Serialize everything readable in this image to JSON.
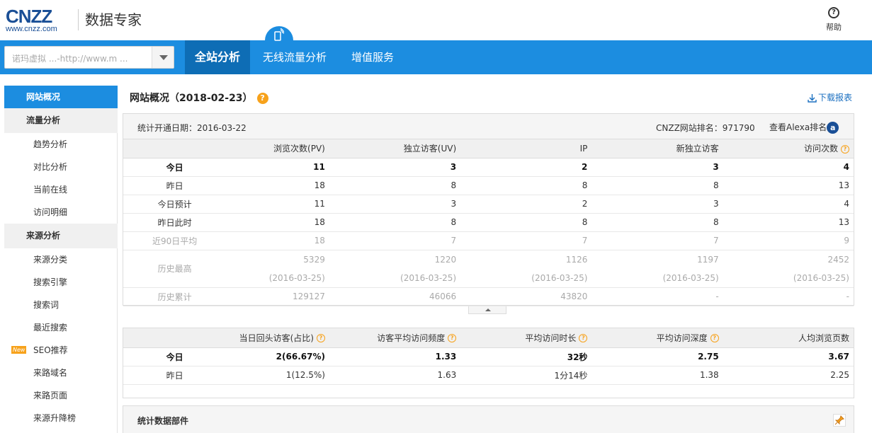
{
  "header": {
    "logo_main": "CNZZ",
    "logo_sub": "www.cnzz.com",
    "brand": "数据专家",
    "help_label": "帮助"
  },
  "site_select": {
    "value": "诺玛虚拟 ...-http://www.m ..."
  },
  "nav": {
    "tabs": [
      "全站分析",
      "无线流量分析",
      "增值服务"
    ],
    "active": "全站分析"
  },
  "sidebar": {
    "items": [
      {
        "label": "网站概况",
        "type": "active"
      },
      {
        "label": "流量分析",
        "type": "group"
      },
      {
        "label": "趋势分析",
        "type": "sub"
      },
      {
        "label": "对比分析",
        "type": "sub"
      },
      {
        "label": "当前在线",
        "type": "sub"
      },
      {
        "label": "访问明细",
        "type": "sub"
      },
      {
        "label": "来源分析",
        "type": "group"
      },
      {
        "label": "来源分类",
        "type": "sub"
      },
      {
        "label": "搜索引擎",
        "type": "sub"
      },
      {
        "label": "搜索词",
        "type": "sub"
      },
      {
        "label": "最近搜索",
        "type": "sub"
      },
      {
        "label": "SEO推荐",
        "type": "sub",
        "badge": "New"
      },
      {
        "label": "来路域名",
        "type": "sub"
      },
      {
        "label": "来路页面",
        "type": "sub"
      },
      {
        "label": "来源升降榜",
        "type": "sub"
      }
    ]
  },
  "main": {
    "title": "网站概况（2018-02-23）",
    "download_label": "下载报表",
    "open_date": "统计开通日期：2016-03-22",
    "rank": "CNZZ网站排名：971790",
    "alexa_label": "查看Alexa排名",
    "alexa_icon": "a"
  },
  "table1": {
    "headers": [
      "",
      "浏览次数(PV)",
      "独立访客(UV)",
      "IP",
      "新独立访客",
      "访问次数"
    ],
    "rows": [
      {
        "cells": [
          "今日",
          "11",
          "3",
          "2",
          "3",
          "4"
        ],
        "style": "bold"
      },
      {
        "cells": [
          "昨日",
          "18",
          "8",
          "8",
          "8",
          "13"
        ],
        "style": ""
      },
      {
        "cells": [
          "今日预计",
          "11",
          "3",
          "2",
          "3",
          "4"
        ],
        "style": ""
      },
      {
        "cells": [
          "昨日此时",
          "18",
          "8",
          "8",
          "8",
          "13"
        ],
        "style": ""
      },
      {
        "cells": [
          "近90日平均",
          "18",
          "7",
          "7",
          "7",
          "9"
        ],
        "style": "gray"
      },
      {
        "cells": [
          "历史最高",
          "5329",
          "1220",
          "1126",
          "1197",
          "2452"
        ],
        "style": "gray",
        "dates": [
          "(2016-03-25)",
          "(2016-03-25)",
          "(2016-03-25)",
          "(2016-03-25)",
          "(2016-03-25)"
        ]
      },
      {
        "cells": [
          "历史累计",
          "129127",
          "46066",
          "43820",
          "-",
          "-"
        ],
        "style": "gray"
      }
    ]
  },
  "table2": {
    "headers": [
      "",
      "当日回头访客(占比)",
      "访客平均访问频度",
      "平均访问时长",
      "平均访问深度",
      "人均浏览页数"
    ],
    "help_cols": [
      1,
      2,
      3,
      4
    ],
    "rows": [
      {
        "cells": [
          "今日",
          "2(66.67%)",
          "1.33",
          "32秒",
          "2.75",
          "3.67"
        ],
        "style": "bold"
      },
      {
        "cells": [
          "昨日",
          "1(12.5%)",
          "1.63",
          "1分14秒",
          "1.38",
          "2.25"
        ],
        "style": ""
      }
    ]
  },
  "panel3": {
    "title": "统计数据部件"
  },
  "colors": {
    "nav_blue": "#1c8de0",
    "nav_active": "#0e6db5",
    "accent_orange": "#f7a21b"
  }
}
